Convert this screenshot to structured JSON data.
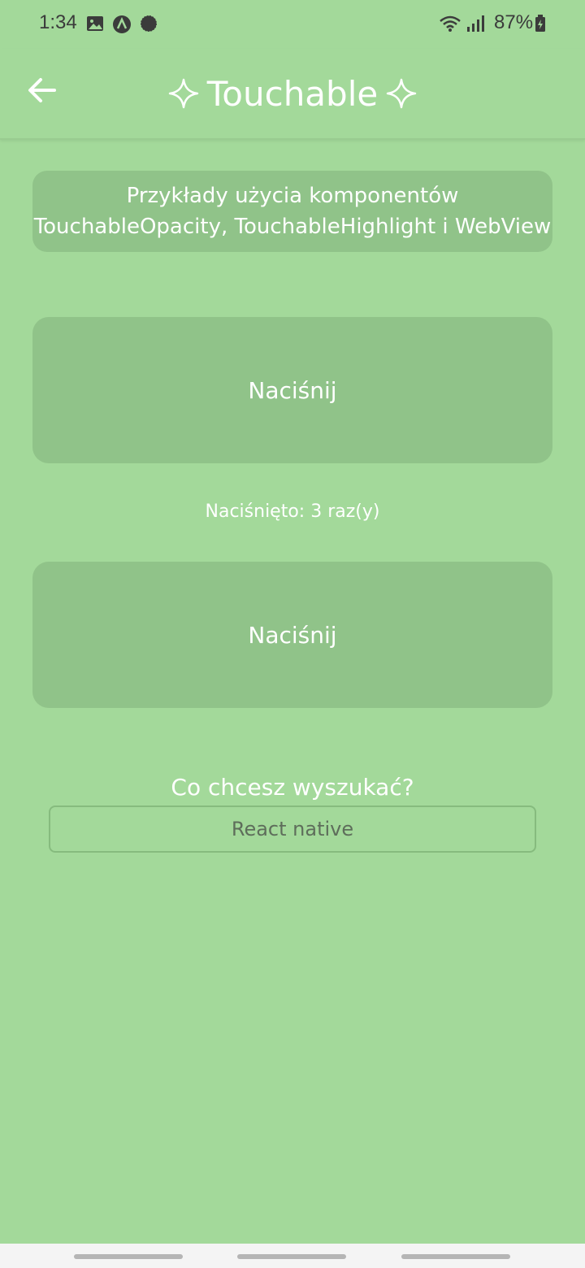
{
  "status_bar": {
    "time": "1:34",
    "battery": "87%",
    "icons": [
      "image-icon",
      "app-a-icon",
      "chat-bubble-icon",
      "wifi-icon",
      "signal-icon",
      "battery-charging-icon"
    ]
  },
  "header": {
    "title": "Touchable",
    "back_icon": "arrow-left-icon",
    "decoration_icon": "sparkle-icon"
  },
  "description": {
    "line1": "Przykłady użycia komponentów",
    "line2": "TouchableOpacity, TouchableHighlight i WebView"
  },
  "buttons": {
    "opacity_label": "Naciśnij",
    "highlight_label": "Naciśnij"
  },
  "counter": {
    "text": "Naciśnięto: 3 raz(y)"
  },
  "search": {
    "label": "Co chcesz wyszukać?",
    "value": "React native",
    "placeholder": ""
  },
  "colors": {
    "background": "#a3d99a",
    "button": "#90c389",
    "text": "#ffffff"
  }
}
